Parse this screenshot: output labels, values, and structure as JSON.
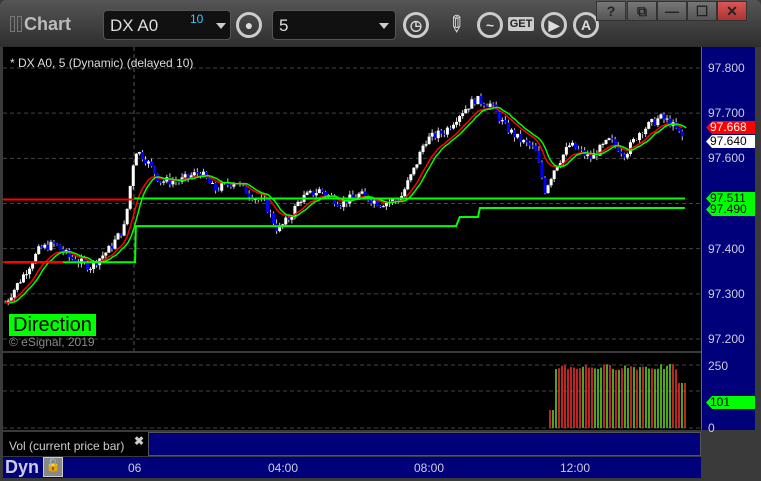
{
  "window": {
    "title": "Chart",
    "help": "?",
    "link": "⧉",
    "minimize": "—",
    "maximize": "☐",
    "close": "✕"
  },
  "toolbar": {
    "symbol": "DX A0",
    "symbol_badge": "10",
    "interval": "5",
    "get_label": "GET",
    "analysis_label": "A"
  },
  "chart": {
    "header": "* DX A0, 5 (Dynamic) (delayed 10)",
    "direction_label": "Direction",
    "copyright": "© eSignal, 2019",
    "price_labels": [
      "97.800",
      "97.700",
      "97.600",
      "97.400",
      "97.300",
      "97.200"
    ],
    "tags": [
      {
        "value": "97.668",
        "bg": "#ff0000",
        "fg": "#ffffff"
      },
      {
        "value": "97.640",
        "bg": "#ffffff",
        "fg": "#000000"
      },
      {
        "value": "97.511",
        "bg": "#00ff00",
        "fg": "#000000"
      },
      {
        "value": "97.490",
        "bg": "#00ff00",
        "fg": "#000000"
      }
    ]
  },
  "volume": {
    "title": "Vol (current price bar)",
    "labels": [
      "250",
      "0"
    ],
    "tag": "101"
  },
  "time_axis": {
    "corner": "Dyn",
    "labels": [
      "06",
      "04:00",
      "08:00",
      "12:00"
    ]
  },
  "colors": {
    "up": "#ffffff",
    "down": "#0000ff",
    "fast_ma": "#ff0000",
    "slow_ma": "#00ff00",
    "axis_bg": "#00007a"
  },
  "chart_data": {
    "type": "candlestick",
    "xunit": "hours from 00:00",
    "ylim": [
      97.2,
      97.8
    ],
    "close_path": [
      [
        -3.52,
        97.28
      ],
      [
        -3.11,
        97.33
      ],
      [
        -2.57,
        97.4
      ],
      [
        -2.16,
        97.41
      ],
      [
        -1.75,
        97.38
      ],
      [
        -1.2,
        97.36
      ],
      [
        -0.66,
        97.4
      ],
      [
        -0.25,
        97.45
      ],
      [
        0.03,
        97.62
      ],
      [
        0.3,
        97.6
      ],
      [
        0.71,
        97.55
      ],
      [
        1.26,
        97.55
      ],
      [
        1.8,
        97.57
      ],
      [
        2.21,
        97.53
      ],
      [
        2.76,
        97.55
      ],
      [
        3.17,
        97.52
      ],
      [
        3.58,
        97.5
      ],
      [
        3.93,
        97.44
      ],
      [
        4.26,
        97.47
      ],
      [
        4.54,
        97.51
      ],
      [
        5.08,
        97.53
      ],
      [
        5.63,
        97.5
      ],
      [
        6.17,
        97.52
      ],
      [
        6.72,
        97.5
      ],
      [
        7.27,
        97.51
      ],
      [
        7.68,
        97.58
      ],
      [
        7.95,
        97.64
      ],
      [
        8.5,
        97.66
      ],
      [
        8.91,
        97.7
      ],
      [
        9.32,
        97.73
      ],
      [
        9.73,
        97.72
      ],
      [
        10.14,
        97.67
      ],
      [
        10.55,
        97.64
      ],
      [
        10.96,
        97.62
      ],
      [
        11.23,
        97.53
      ],
      [
        11.5,
        97.58
      ],
      [
        11.91,
        97.63
      ],
      [
        12.46,
        97.6
      ],
      [
        13.0,
        97.64
      ],
      [
        13.42,
        97.61
      ],
      [
        13.83,
        97.66
      ],
      [
        14.37,
        97.69
      ],
      [
        14.64,
        97.68
      ],
      [
        15.05,
        97.64
      ]
    ],
    "support_steps": [
      [
        -3.52,
        97.37
      ],
      [
        0.03,
        97.37
      ],
      [
        0.05,
        97.45
      ],
      [
        8.8,
        97.45
      ],
      [
        8.9,
        97.47
      ],
      [
        9.4,
        97.47
      ],
      [
        9.45,
        97.49
      ],
      [
        15.05,
        97.49
      ]
    ],
    "level_line": 97.511
  }
}
